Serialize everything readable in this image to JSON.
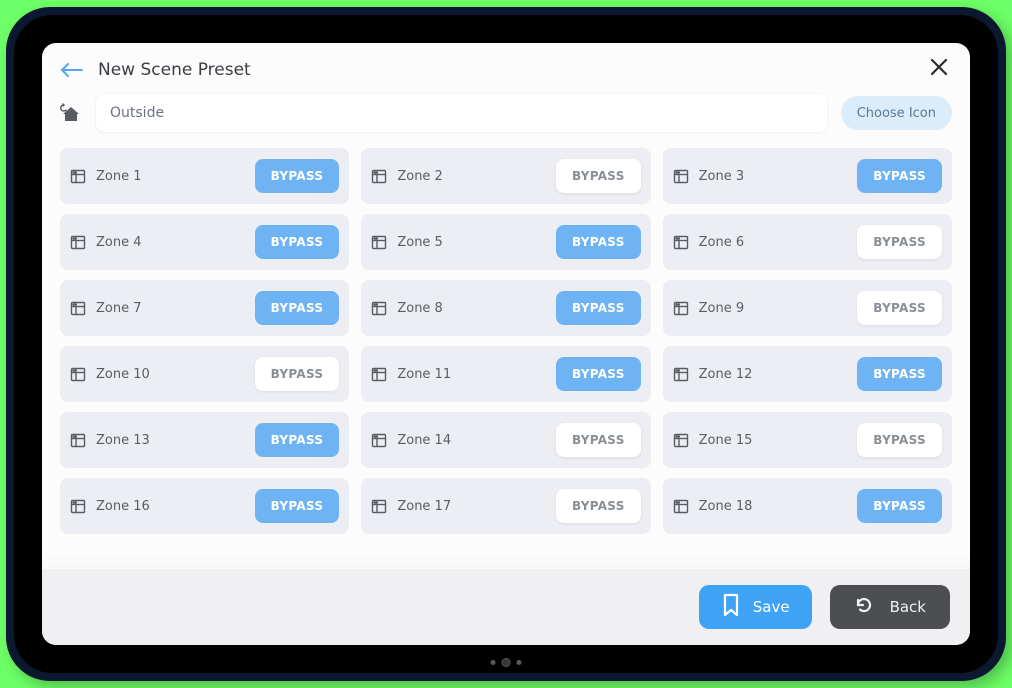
{
  "header": {
    "title": "New Scene Preset",
    "back_icon": "arrow-left",
    "close_icon": "x"
  },
  "nameRow": {
    "icon": "home-refresh",
    "value": "Outside",
    "chooseIconLabel": "Choose Icon"
  },
  "bypassLabel": "BYPASS",
  "zones": [
    {
      "label": "Zone 1",
      "bypass": true
    },
    {
      "label": "Zone 2",
      "bypass": false
    },
    {
      "label": "Zone 3",
      "bypass": true
    },
    {
      "label": "Zone 4",
      "bypass": true
    },
    {
      "label": "Zone 5",
      "bypass": true
    },
    {
      "label": "Zone 6",
      "bypass": false
    },
    {
      "label": "Zone 7",
      "bypass": true
    },
    {
      "label": "Zone 8",
      "bypass": true
    },
    {
      "label": "Zone 9",
      "bypass": false
    },
    {
      "label": "Zone 10",
      "bypass": false
    },
    {
      "label": "Zone 11",
      "bypass": true
    },
    {
      "label": "Zone 12",
      "bypass": true
    },
    {
      "label": "Zone 13",
      "bypass": true
    },
    {
      "label": "Zone 14",
      "bypass": false
    },
    {
      "label": "Zone 15",
      "bypass": false
    },
    {
      "label": "Zone 16",
      "bypass": true
    },
    {
      "label": "Zone 17",
      "bypass": false
    },
    {
      "label": "Zone 18",
      "bypass": true
    }
  ],
  "footer": {
    "saveLabel": "Save",
    "backLabel": "Back"
  },
  "colors": {
    "accent": "#6eb3f3",
    "accentStrong": "#3fa3f5",
    "card": "#edeef3",
    "textMuted": "#595e64"
  }
}
